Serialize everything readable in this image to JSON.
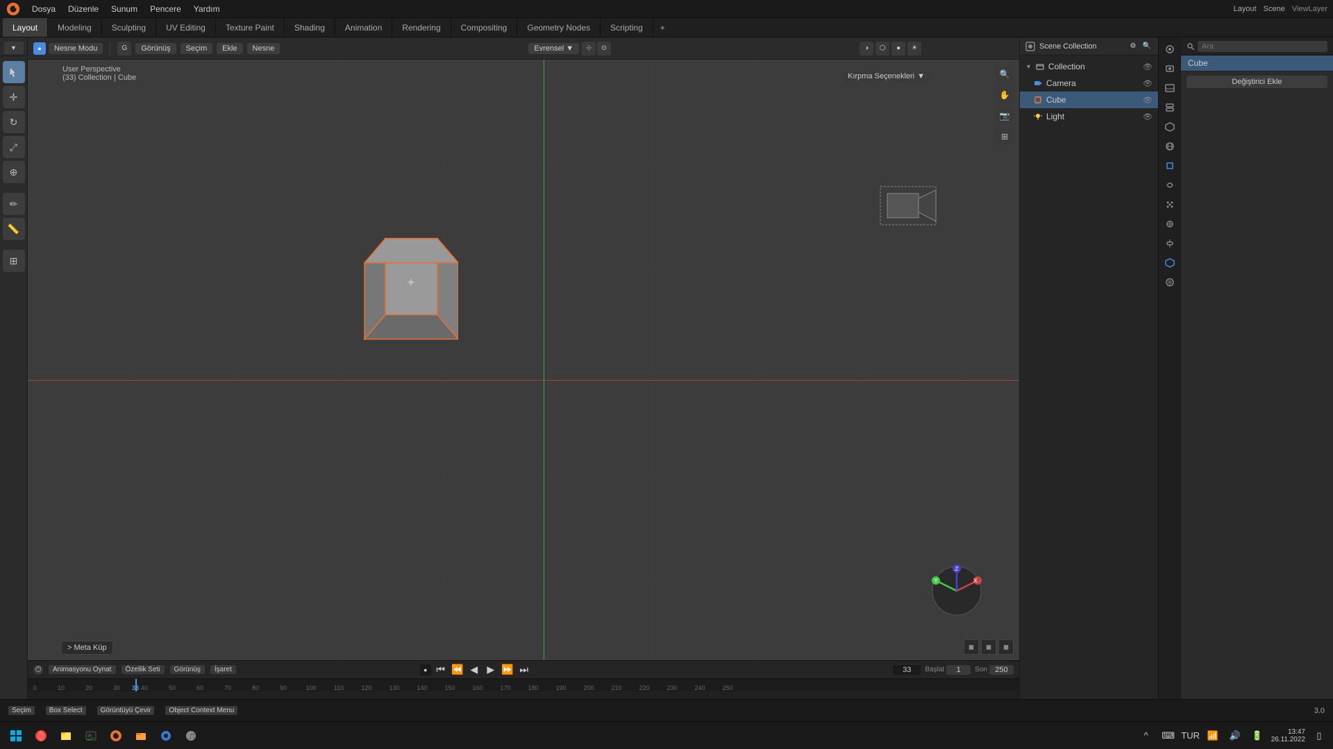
{
  "app": {
    "title": "Blender",
    "logo": "B"
  },
  "top_menu": {
    "items": [
      "Dosya",
      "Düzenle",
      "Sunum",
      "Pencere",
      "Yardım"
    ]
  },
  "workspace_tabs": {
    "tabs": [
      "Layout",
      "Modeling",
      "Sculpting",
      "UV Editing",
      "Texture Paint",
      "Shading",
      "Animation",
      "Rendering",
      "Compositing",
      "Geometry Nodes",
      "Scripting"
    ],
    "active": "Layout",
    "plus": "+"
  },
  "viewport_header": {
    "mode": "Nesne Modu",
    "view_menu": "Görünüş",
    "select_menu": "Seçim",
    "add_menu": "Ekle",
    "object_menu": "Nesne",
    "environment": "Evrensel",
    "kirpma": "Kırpma Seçenekleri"
  },
  "viewport": {
    "info_line1": "User Perspective",
    "info_line2": "(33) Collection | Cube"
  },
  "scene_collection": {
    "title": "Scene Collection",
    "label": "Scene",
    "view_layer": "ViewLayer",
    "items": [
      {
        "name": "Collection",
        "indent": 0,
        "type": "collection",
        "expanded": true
      },
      {
        "name": "Camera",
        "indent": 1,
        "type": "camera"
      },
      {
        "name": "Cube",
        "indent": 1,
        "type": "mesh",
        "selected": true
      },
      {
        "name": "Light",
        "indent": 1,
        "type": "light"
      }
    ]
  },
  "properties_panel": {
    "search_placeholder": "Ara",
    "active_object": "Cube",
    "add_modifier_btn": "Değiştirici Ekle",
    "icons": [
      "scene",
      "render",
      "output",
      "view_layer",
      "scene_props",
      "world",
      "object",
      "modifier",
      "particles",
      "physics",
      "constraints",
      "object_data",
      "material",
      "texture"
    ]
  },
  "timeline": {
    "controls": [
      "Animasyonu Oynat",
      "Özellik Seti",
      "Görünüş",
      "İşaret"
    ],
    "frame_current": "33",
    "frame_start_label": "Başlat",
    "frame_start": "1",
    "frame_end_label": "Son",
    "frame_end": "250",
    "playback_btns": [
      "⏮",
      "⏪",
      "⏴",
      "⏵",
      "⏩",
      "⏭"
    ],
    "ruler_marks": [
      "0",
      "10",
      "20",
      "30",
      "40",
      "50",
      "60",
      "70",
      "80",
      "90",
      "100",
      "110",
      "120",
      "130",
      "140",
      "150",
      "160",
      "170",
      "180",
      "190",
      "200",
      "210",
      "220",
      "230",
      "240",
      "250"
    ]
  },
  "status_bar": {
    "items": [
      {
        "key": "Seçim",
        "value": ""
      },
      {
        "key": "Box Select",
        "value": ""
      },
      {
        "key": "Görüntüyü Çevir",
        "value": ""
      },
      {
        "key": "Object Context Menu",
        "value": ""
      }
    ],
    "right_value": "3.0"
  },
  "meta_kup": "> Meta Küp",
  "taskbar": {
    "icons": [
      "⊞",
      "🌐",
      "🗂",
      "💻",
      "🐝",
      "📁",
      "🔊",
      "🐜"
    ],
    "right": {
      "lang": "TUR",
      "time": "26.11.2022"
    }
  }
}
